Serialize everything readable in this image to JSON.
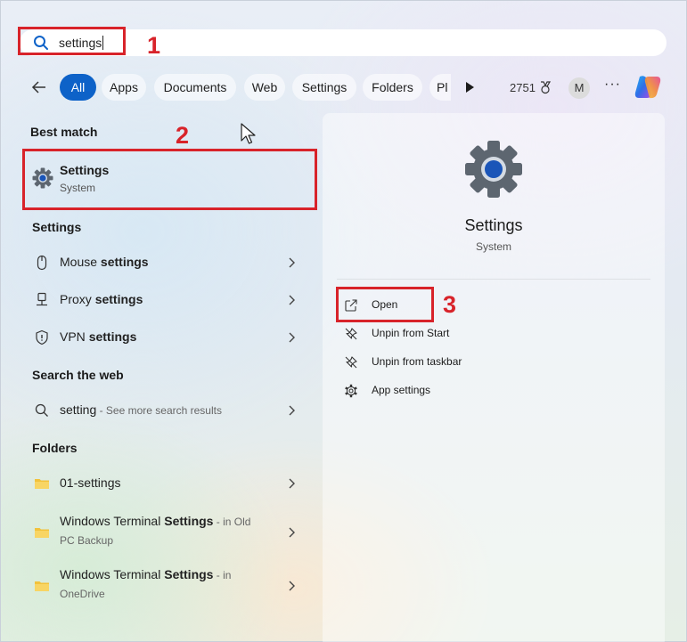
{
  "search": {
    "query": "settings",
    "placeholder": ""
  },
  "tabs": [
    {
      "label": "All",
      "active": true
    },
    {
      "label": "Apps"
    },
    {
      "label": "Documents"
    },
    {
      "label": "Web"
    },
    {
      "label": "Settings"
    },
    {
      "label": "Folders"
    },
    {
      "label": "Pl"
    }
  ],
  "toolbar": {
    "points": "2751",
    "avatar_initial": "M",
    "more": "···"
  },
  "best_match": {
    "heading": "Best match",
    "title": "Settings",
    "subtitle": "System"
  },
  "settings_section": {
    "heading": "Settings",
    "items": [
      {
        "prefix": "Mouse ",
        "bold": "settings",
        "icon": "mouse-icon"
      },
      {
        "prefix": "Proxy ",
        "bold": "settings",
        "icon": "network-icon"
      },
      {
        "prefix": "VPN ",
        "bold": "settings",
        "icon": "shield-icon"
      }
    ]
  },
  "web_section": {
    "heading": "Search the web",
    "item": {
      "query": "setting",
      "suffix": " - See more search results"
    }
  },
  "folders_section": {
    "heading": "Folders",
    "items": [
      {
        "name": "01-settings"
      },
      {
        "name_prefix": "Windows Terminal ",
        "name_bold": "Settings",
        "loc_line1": " - in Old",
        "loc_line2": "PC Backup"
      },
      {
        "name_prefix": "Windows Terminal ",
        "name_bold": "Settings",
        "loc_line1": " - in",
        "loc_line2": "OneDrive"
      }
    ]
  },
  "preview": {
    "title": "Settings",
    "subtitle": "System",
    "actions": [
      {
        "label": "Open",
        "icon": "open-external-icon"
      },
      {
        "label": "Unpin from Start",
        "icon": "unpin-icon"
      },
      {
        "label": "Unpin from taskbar",
        "icon": "unpin-icon"
      },
      {
        "label": "App settings",
        "icon": "gear-icon"
      }
    ]
  },
  "annotations": [
    "1",
    "2",
    "3"
  ],
  "colors": {
    "accent": "#0d62c8",
    "annotation": "#d8232a"
  }
}
